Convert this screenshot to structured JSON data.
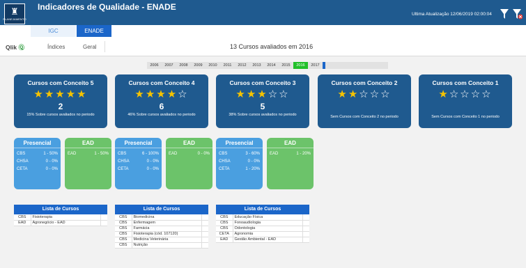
{
  "header": {
    "logo_text": "PLANEJAMENTO",
    "title": "Indicadores de Qualidade - ENADE",
    "last_update": "Ultima Atualização 12/06/2019 02:00:04"
  },
  "tabs": [
    {
      "label": "IGC"
    },
    {
      "label": "ENADE"
    }
  ],
  "subnav": {
    "qlik_label": "Qlik",
    "indices_label": "Índices",
    "geral_label": "Geral"
  },
  "main_title": "13 Cursos avaliados em 2016",
  "years": {
    "items": [
      "2006",
      "2007",
      "2008",
      "2009",
      "2010",
      "2011",
      "2012",
      "2013",
      "2014",
      "2015",
      "2016",
      "2017"
    ],
    "selected": "2016"
  },
  "cards": [
    {
      "title": "Cursos com Conceito 5",
      "stars_on": 5,
      "count": "2",
      "note": "15% Sobre cursos avaliados no periodo"
    },
    {
      "title": "Cursos com Conceito 4",
      "stars_on": 4,
      "count": "6",
      "note": "46% Sobre cursos avaliados no periodo"
    },
    {
      "title": "Cursos com Conceito 3",
      "stars_on": 3,
      "count": "5",
      "note": "38% Sobre cursos avaliados no periodo"
    },
    {
      "title": "Cursos com Conceito 2",
      "stars_on": 2,
      "count": "",
      "note": "Sem Cursos com Conceito 2 no periodo"
    },
    {
      "title": "Cursos com Conceito 1",
      "stars_on": 1,
      "count": "",
      "note": "Sem Cursos com Conceito 1 no periodo"
    }
  ],
  "panels": [
    {
      "title": "Presencial",
      "rows": [
        [
          "CBS",
          "1 - 50%"
        ],
        [
          "CHSA",
          "0 - 0%"
        ],
        [
          "CETA",
          "0 - 0%"
        ]
      ]
    },
    {
      "title": "EAD",
      "rows": [
        [
          "EAD",
          "1 - 50%"
        ]
      ]
    },
    {
      "title": "Presencial",
      "rows": [
        [
          "CBS",
          "6 - 100%"
        ],
        [
          "CHSA",
          "0 - 0%"
        ],
        [
          "CETA",
          "0 - 0%"
        ]
      ]
    },
    {
      "title": "EAD",
      "rows": [
        [
          "EAD",
          "0 - 0%"
        ]
      ]
    },
    {
      "title": "Presencial",
      "rows": [
        [
          "CBS",
          "3 - 60%"
        ],
        [
          "CHSA",
          "0 - 0%"
        ],
        [
          "CETA",
          "1 - 20%"
        ]
      ]
    },
    {
      "title": "EAD",
      "rows": [
        [
          "EAD",
          "1 - 20%"
        ]
      ]
    }
  ],
  "lists": [
    {
      "title": "Lista de Cursos",
      "rows": [
        [
          "CBS",
          "Fisioterapia"
        ],
        [
          "EAD",
          "Agronegócio - EAD"
        ]
      ]
    },
    {
      "title": "Lista de Cursos",
      "rows": [
        [
          "CBS",
          "Biomedicina"
        ],
        [
          "CBS",
          "Enfermagem"
        ],
        [
          "CBS",
          "Farmácia"
        ],
        [
          "CBS",
          "Fisioterapia (cód. 107120)"
        ],
        [
          "CBS",
          "Medicina Veterinária"
        ],
        [
          "CBS",
          "Nutrição"
        ]
      ]
    },
    {
      "title": "Lista de Cursos",
      "rows": [
        [
          "CBS",
          "Educação Física"
        ],
        [
          "CBS",
          "Fonoaudiologia"
        ],
        [
          "CBS",
          "Odontologia"
        ],
        [
          "CETA",
          "Agronomia"
        ],
        [
          "EAD",
          "Gestão Ambiental - EAD"
        ]
      ]
    }
  ],
  "colors": {
    "primary": "#1f5a8f",
    "tab_active": "#1b66c9",
    "star": "#f6c300",
    "presencial": "#4a9fe0",
    "ead": "#6cc36a",
    "selected_year": "#22c02a"
  },
  "icons": {
    "filter": "filter-icon",
    "clear_filter": "clear-filter-icon"
  }
}
